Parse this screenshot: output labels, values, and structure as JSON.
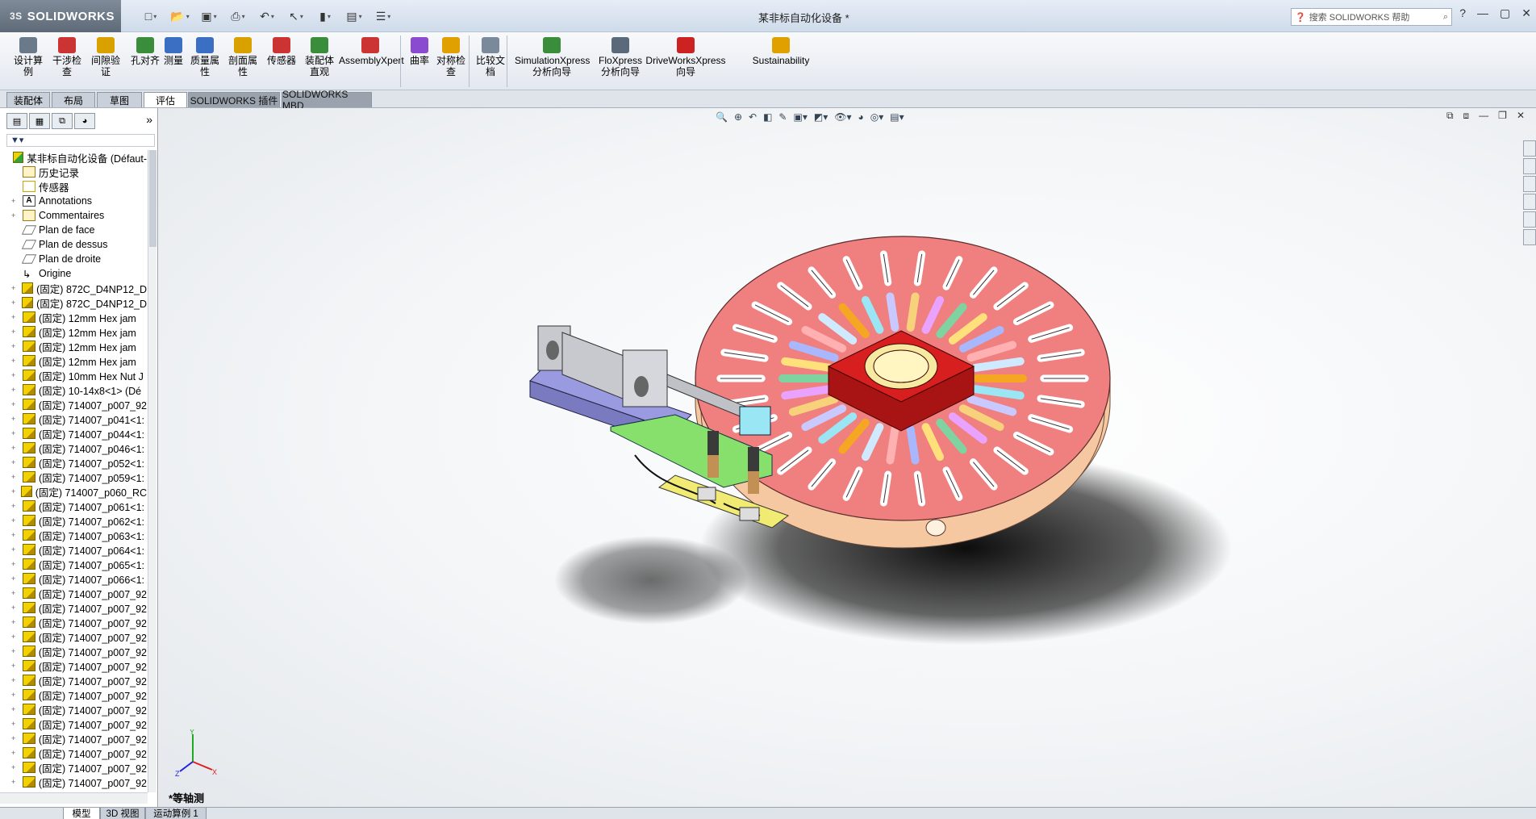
{
  "app": {
    "logo_text": "SOLIDWORKS",
    "logo_prefix": "3S",
    "document_title": "某非标自动化设备 *",
    "search_placeholder": "搜索 SOLIDWORKS 帮助"
  },
  "quick_access": [
    {
      "icon": "new-doc-icon",
      "glyph": "□"
    },
    {
      "icon": "open-folder-icon",
      "glyph": "📂"
    },
    {
      "icon": "save-icon",
      "glyph": "▣"
    },
    {
      "icon": "print-icon",
      "glyph": "⎙"
    },
    {
      "icon": "undo-icon",
      "glyph": "↶"
    },
    {
      "icon": "select-icon",
      "glyph": "↖"
    },
    {
      "icon": "rebuild-icon",
      "glyph": "▮"
    },
    {
      "icon": "file-props-icon",
      "glyph": "▤"
    },
    {
      "icon": "options-icon",
      "glyph": "☰"
    }
  ],
  "ribbon": {
    "buttons": [
      {
        "id": "design-study",
        "label": "设计算\n例",
        "color": "#6a7a8a"
      },
      {
        "id": "interference",
        "label": "干涉检\n查",
        "color": "#cc3333"
      },
      {
        "id": "clearance",
        "label": "间隙验\n证",
        "color": "#d9a100"
      },
      {
        "id": "hole-align",
        "label": "孔对齐",
        "color": "#3a8d3a"
      },
      {
        "id": "measure",
        "label": "测量",
        "color": "#3a6fc4"
      },
      {
        "id": "mass-props",
        "label": "质量属\n性",
        "color": "#3a6fc4"
      },
      {
        "id": "section-props",
        "label": "剖面属\n性",
        "color": "#d9a100"
      },
      {
        "id": "sensor",
        "label": "传感器",
        "color": "#cc3333"
      },
      {
        "id": "asm-visual",
        "label": "装配体\n直观",
        "color": "#3a8d3a"
      },
      {
        "id": "assemblyxpert",
        "label": "AssemblyXpert",
        "color": "#cc3333"
      },
      {
        "id": "curvature",
        "label": "曲率",
        "color": "#8a4bd0"
      },
      {
        "id": "symmetry",
        "label": "对称检\n查",
        "color": "#e0a000"
      },
      {
        "id": "compare-docs",
        "label": "比较文\n档",
        "color": "#7a8a9a"
      },
      {
        "id": "simulationxpress",
        "label": "SimulationXpress\n分析向导",
        "color": "#3a8d3a"
      },
      {
        "id": "floxpress",
        "label": "FloXpress\n分析向导",
        "color": "#5a6a7a"
      },
      {
        "id": "driveworksxpress",
        "label": "DriveWorksXpress\n向导",
        "color": "#cc2222"
      },
      {
        "id": "sustainability",
        "label": "Sustainability",
        "color": "#e0a000"
      }
    ]
  },
  "command_tabs": [
    {
      "label": "装配体",
      "active": false
    },
    {
      "label": "布局",
      "active": false
    },
    {
      "label": "草图",
      "active": false
    },
    {
      "label": "评估",
      "active": true
    },
    {
      "label": "SOLIDWORKS 插件",
      "active": false
    },
    {
      "label": "SOLIDWORKS MBD",
      "active": false
    }
  ],
  "feature_manager": {
    "tree": [
      {
        "label": "某非标自动化设备  (Défaut-",
        "icon": "asm",
        "exp": ""
      },
      {
        "label": "历史记录",
        "icon": "hist",
        "exp": ""
      },
      {
        "label": "传感器",
        "icon": "sens",
        "exp": ""
      },
      {
        "label": "Annotations",
        "icon": "anno",
        "exp": "+"
      },
      {
        "label": "Commentaires",
        "icon": "hist",
        "exp": "+"
      },
      {
        "label": "Plan de face",
        "icon": "plane",
        "exp": ""
      },
      {
        "label": "Plan de dessus",
        "icon": "plane",
        "exp": ""
      },
      {
        "label": "Plan de droite",
        "icon": "plane",
        "exp": ""
      },
      {
        "label": "Origine",
        "icon": "orig",
        "exp": ""
      },
      {
        "label": "(固定) 872C_D4NP12_D",
        "icon": "part",
        "exp": "+"
      },
      {
        "label": "(固定) 872C_D4NP12_D",
        "icon": "part",
        "exp": "+"
      },
      {
        "label": "(固定) 12mm  Hex jam",
        "icon": "part",
        "exp": "+"
      },
      {
        "label": "(固定) 12mm  Hex jam",
        "icon": "part",
        "exp": "+"
      },
      {
        "label": "(固定) 12mm  Hex jam",
        "icon": "part",
        "exp": "+"
      },
      {
        "label": "(固定) 12mm  Hex jam",
        "icon": "part",
        "exp": "+"
      },
      {
        "label": "(固定) 10mm Hex Nut J",
        "icon": "part",
        "exp": "+"
      },
      {
        "label": "(固定) 10-14x8<1> (Dé",
        "icon": "part",
        "exp": "+"
      },
      {
        "label": "(固定) 714007_p007_92",
        "icon": "part",
        "exp": "+"
      },
      {
        "label": "(固定) 714007_p041<1:",
        "icon": "part",
        "exp": "+"
      },
      {
        "label": "(固定) 714007_p044<1:",
        "icon": "part",
        "exp": "+"
      },
      {
        "label": "(固定) 714007_p046<1:",
        "icon": "part",
        "exp": "+"
      },
      {
        "label": "(固定) 714007_p052<1:",
        "icon": "part",
        "exp": "+"
      },
      {
        "label": "(固定) 714007_p059<1:",
        "icon": "part",
        "exp": "+"
      },
      {
        "label": "(固定) 714007_p060_RC",
        "icon": "part",
        "exp": "+"
      },
      {
        "label": "(固定) 714007_p061<1:",
        "icon": "part",
        "exp": "+"
      },
      {
        "label": "(固定) 714007_p062<1:",
        "icon": "part",
        "exp": "+"
      },
      {
        "label": "(固定) 714007_p063<1:",
        "icon": "part",
        "exp": "+"
      },
      {
        "label": "(固定) 714007_p064<1:",
        "icon": "part",
        "exp": "+"
      },
      {
        "label": "(固定) 714007_p065<1:",
        "icon": "part",
        "exp": "+"
      },
      {
        "label": "(固定) 714007_p066<1:",
        "icon": "part",
        "exp": "+"
      },
      {
        "label": "(固定) 714007_p007_92",
        "icon": "part",
        "exp": "+"
      },
      {
        "label": "(固定) 714007_p007_92",
        "icon": "part",
        "exp": "+"
      },
      {
        "label": "(固定) 714007_p007_92",
        "icon": "part",
        "exp": "+"
      },
      {
        "label": "(固定) 714007_p007_92",
        "icon": "part",
        "exp": "+"
      },
      {
        "label": "(固定) 714007_p007_92",
        "icon": "part",
        "exp": "+"
      },
      {
        "label": "(固定) 714007_p007_92",
        "icon": "part",
        "exp": "+"
      },
      {
        "label": "(固定) 714007_p007_92",
        "icon": "part",
        "exp": "+"
      },
      {
        "label": "(固定) 714007_p007_92",
        "icon": "part",
        "exp": "+"
      },
      {
        "label": "(固定) 714007_p007_92",
        "icon": "part",
        "exp": "+"
      },
      {
        "label": "(固定) 714007_p007_92",
        "icon": "part",
        "exp": "+"
      },
      {
        "label": "(固定) 714007_p007_92",
        "icon": "part",
        "exp": "+"
      },
      {
        "label": "(固定) 714007_p007_92",
        "icon": "part",
        "exp": "+"
      },
      {
        "label": "(固定) 714007_p007_92",
        "icon": "part",
        "exp": "+"
      },
      {
        "label": "(固定) 714007_p007_92",
        "icon": "part",
        "exp": "+"
      }
    ]
  },
  "viewport": {
    "view_label": "*等轴测",
    "triad": {
      "x": "X",
      "y": "Y",
      "z": "Z"
    }
  },
  "bottom_tabs": [
    {
      "label": "模型",
      "active": true
    },
    {
      "label": "3D 视图",
      "active": false
    },
    {
      "label": "运动算例 1",
      "active": false
    }
  ],
  "colors": {
    "disk_top": "#f07f7f",
    "disk_side": "#f6c8a2",
    "center_block": "#d81f1f",
    "cylinder": "#c7c9cf",
    "bracket_green": "#86e06b",
    "bracket_yellow": "#f1ea73",
    "base_purple": "#9a9ae0"
  }
}
